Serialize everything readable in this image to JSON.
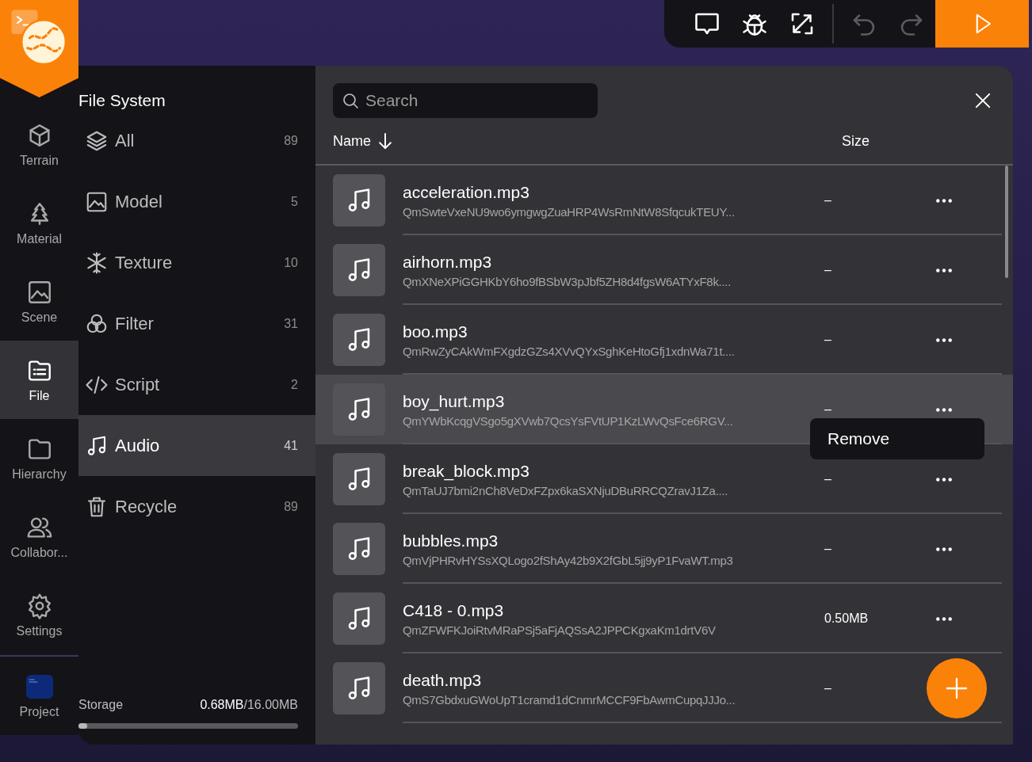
{
  "toolbar": {
    "tools": [
      {
        "disabled": false
      },
      {
        "disabled": false
      },
      {
        "disabled": false
      },
      {
        "disabled": true
      },
      {
        "disabled": true
      }
    ]
  },
  "rail": {
    "items": [
      {
        "label": "Terrain",
        "selected": false
      },
      {
        "label": "Material",
        "selected": false
      },
      {
        "label": "Scene",
        "selected": false
      },
      {
        "label": "File",
        "selected": true
      },
      {
        "label": "Hierarchy",
        "selected": false
      },
      {
        "label": "Collabor...",
        "selected": false
      },
      {
        "label": "Settings",
        "selected": false
      }
    ],
    "project": {
      "label": "Project"
    }
  },
  "file_system": {
    "title": "File System",
    "categories": [
      {
        "label": "All",
        "count": "89",
        "selected": false
      },
      {
        "label": "Model",
        "count": "5",
        "selected": false
      },
      {
        "label": "Texture",
        "count": "10",
        "selected": false
      },
      {
        "label": "Filter",
        "count": "31",
        "selected": false
      },
      {
        "label": "Script",
        "count": "2",
        "selected": false
      },
      {
        "label": "Audio",
        "count": "41",
        "selected": true
      },
      {
        "label": "Recycle",
        "count": "89",
        "selected": false
      }
    ],
    "storage": {
      "label": "Storage",
      "used": "0.68MB",
      "total": "/16.00MB",
      "level": 0.04
    }
  },
  "browser": {
    "search": {
      "placeholder": "Search"
    },
    "columns": [
      {
        "label": "Name",
        "sorted": true
      },
      {
        "label": "Size",
        "sorted": false
      }
    ],
    "files": [
      {
        "name": "acceleration.mp3",
        "hash": "QmSwteVxeNU9wo6ymgwgZuaHRP4WsRmNtW8SfqcukTEUY...",
        "size": "–",
        "highlighted": false
      },
      {
        "name": "airhorn.mp3",
        "hash": "QmXNeXPiGGHKbY6ho9fBSbW3pJbf5ZH8d4fgsW6ATYxF8k....",
        "size": "–",
        "highlighted": false
      },
      {
        "name": "boo.mp3",
        "hash": "QmRwZyCAkWmFXgdzGZs4XVvQYxSghKeHtoGfj1xdnWa71t....",
        "size": "–",
        "highlighted": false
      },
      {
        "name": "boy_hurt.mp3",
        "hash": "QmYWbKcqgVSgo5gXVwb7QcsYsFVtUP1KzLWvQsFce6RGV...",
        "size": "–",
        "highlighted": true,
        "menu": [
          "Remove"
        ]
      },
      {
        "name": "break_block.mp3",
        "hash": "QmTaUJ7bmi2nCh8VeDxFZpx6kaSXNjuDBuRRCQZravJ1Za....",
        "size": "–",
        "highlighted": false
      },
      {
        "name": "bubbles.mp3",
        "hash": "QmVjPHRvHYSsXQLogo2fShAy42b9X2fGbL5jj9yP1FvaWT.mp3",
        "size": "–",
        "highlighted": false
      },
      {
        "name": "C418 - 0.mp3",
        "hash": "QmZFWFKJoiRtvMRaPSj5aFjAQSsA2JPPCKgxaKm1drtV6V",
        "size": "0.50MB",
        "highlighted": false
      },
      {
        "name": "death.mp3",
        "hash": "QmS7GbdxuGWoUpT1cramd1dCnmrMCCF9FbAwmCupqJJJo...",
        "size": "–",
        "highlighted": false
      }
    ]
  }
}
